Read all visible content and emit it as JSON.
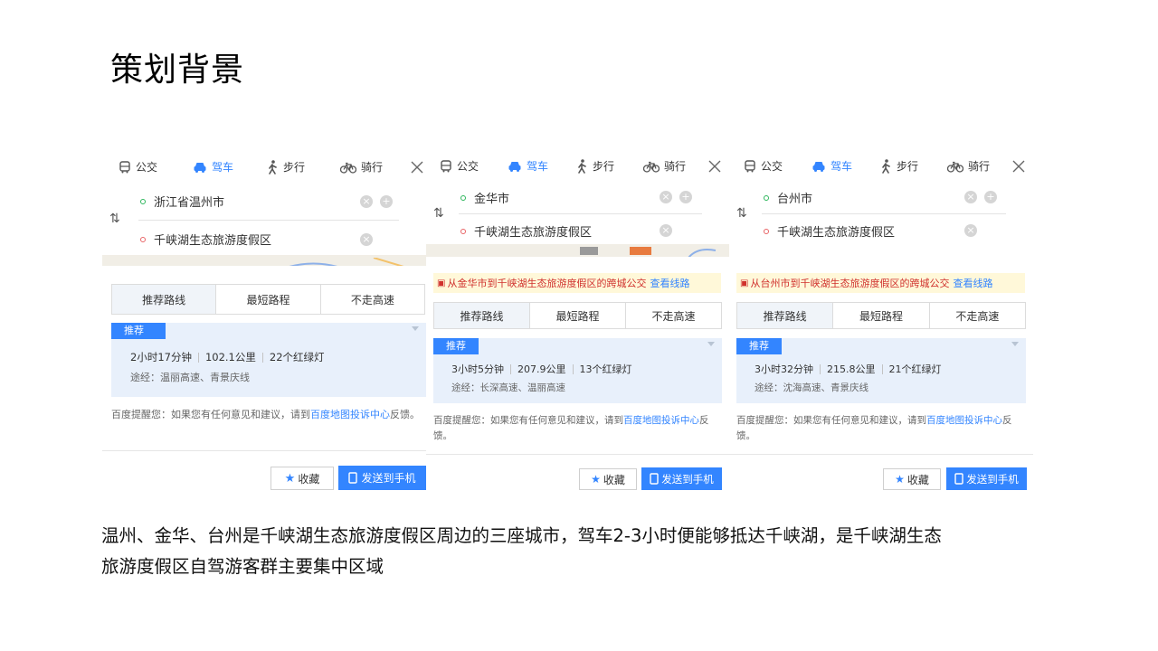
{
  "slide": {
    "title": "策划背景",
    "caption_line1": "温州、金华、台州是千峡湖生态旅游度假区周边的三座城市，驾车2-3小时便能够抵达千峡湖，是千峡湖生态",
    "caption_line2": "旅游度假区自驾游客群主要集中区域"
  },
  "colors": {
    "accent": "#3385ff",
    "start_dot": "#2db65c",
    "end_dot": "#e86466",
    "notice_bg": "#fff8d9",
    "notice_text": "#d0312d"
  },
  "tabs": {
    "bus": "公交",
    "drive": "驾车",
    "walk": "步行",
    "bike": "骑行",
    "active": "drive"
  },
  "icons": {
    "bus": "bus-icon",
    "drive": "car-icon",
    "walk": "walk-icon",
    "bike": "bike-icon",
    "close": "close-icon",
    "swap": "swap-icon",
    "add": "plus-icon",
    "clear": "clear-icon",
    "star": "star-icon",
    "phone": "phone-icon"
  },
  "modes": {
    "recommended": "推荐路线",
    "shortest": "最短路程",
    "no_highway": "不走高速"
  },
  "rec_badge": "推荐",
  "tip": {
    "prefix": "百度提醒您：如果您有任何意见和建议，请到",
    "link": "百度地图投诉中心",
    "suffix": "反馈。"
  },
  "buttons": {
    "favorite": "收藏",
    "send": "发送到手机"
  },
  "panels": [
    {
      "start": "浙江省温州市",
      "end": "千峡湖生态旅游度假区",
      "notice": "",
      "notice_link": "",
      "time": "2小时17分钟",
      "distance": "102.1公里",
      "lights": "22个红绿灯",
      "via": "途经：温丽高速、青景庆线"
    },
    {
      "start": "金华市",
      "end": "千峡湖生态旅游度假区",
      "notice": "从金华市到千峡湖生态旅游度假区的跨城公交",
      "notice_link": "查看线路",
      "time": "3小时5分钟",
      "distance": "207.9公里",
      "lights": "13个红绿灯",
      "via": "途经：长深高速、温丽高速"
    },
    {
      "start": "台州市",
      "end": "千峡湖生态旅游度假区",
      "notice": "从台州市到千峡湖生态旅游度假区的跨城公交",
      "notice_link": "查看线路",
      "time": "3小时32分钟",
      "distance": "215.8公里",
      "lights": "21个红绿灯",
      "via": "途经：沈海高速、青景庆线"
    }
  ]
}
